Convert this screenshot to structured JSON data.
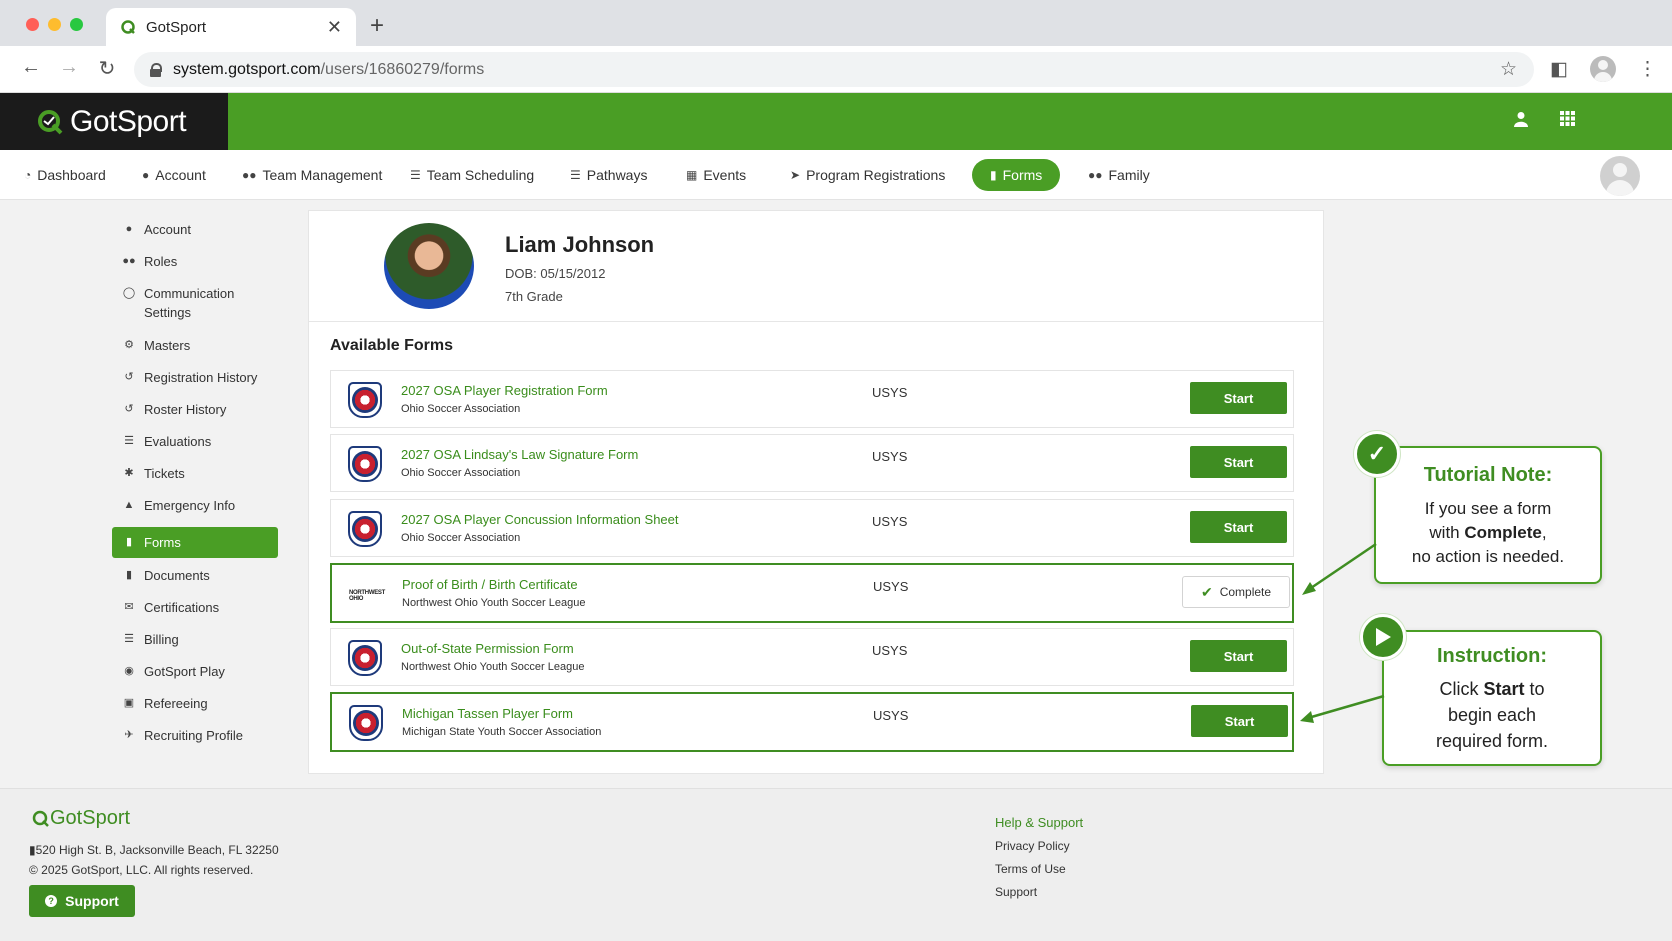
{
  "browser": {
    "tab_title": "GotSport",
    "url_host": "system.gotsport.com",
    "url_path": "/users/16860279/forms"
  },
  "header": {
    "logo": "GotSport",
    "brand_color": "#4a9e25"
  },
  "nav": {
    "items": [
      {
        "label": "Dashboard",
        "icon": "dashboard-icon"
      },
      {
        "label": "Account",
        "icon": "user-icon"
      },
      {
        "label": "Team Management",
        "icon": "users-icon"
      },
      {
        "label": "Team Scheduling",
        "icon": "list-icon"
      },
      {
        "label": "Pathways",
        "icon": "list-icon"
      },
      {
        "label": "Events",
        "icon": "calendar-icon"
      },
      {
        "label": "Program Registrations",
        "icon": "paper-plane-icon"
      },
      {
        "label": "Forms",
        "icon": "file-icon"
      },
      {
        "label": "Family",
        "icon": "users-icon"
      }
    ],
    "active": "Forms"
  },
  "sidebar": {
    "items": [
      {
        "label": "Account",
        "icon": "user-icon"
      },
      {
        "label": "Roles",
        "icon": "users-icon"
      },
      {
        "label": "Communication",
        "label2": "Settings",
        "icon": "chat-icon"
      },
      {
        "label": "Masters",
        "icon": "gear-icon"
      },
      {
        "label": "Registration History",
        "icon": "history-icon"
      },
      {
        "label": "Roster History",
        "icon": "history-icon"
      },
      {
        "label": "Evaluations",
        "icon": "list-icon"
      },
      {
        "label": "Tickets",
        "icon": "tickets-icon"
      },
      {
        "label": "Emergency Info",
        "icon": "lock-icon"
      },
      {
        "label": "Forms",
        "icon": "file-icon"
      },
      {
        "label": "Documents",
        "icon": "file-icon"
      },
      {
        "label": "Certifications",
        "icon": "envelope-icon"
      },
      {
        "label": "Billing",
        "icon": "list-icon"
      },
      {
        "label": "GotSport Play",
        "icon": "play-circle-icon"
      },
      {
        "label": "Refereeing",
        "icon": "refereeing-icon"
      },
      {
        "label": "Recruiting Profile",
        "icon": "rocket-icon"
      }
    ],
    "active": "Forms"
  },
  "profile": {
    "name": "Liam Johnson",
    "dob": "DOB: 05/15/2012",
    "grade": "7th Grade"
  },
  "forms": {
    "heading": "Available Forms",
    "rows": [
      {
        "title": "2027 OSA Player Registration Form",
        "org": "Ohio Soccer Association",
        "type": "USYS",
        "action": "Start"
      },
      {
        "title": "2027 OSA Lindsay's Law Signature Form",
        "org": "Ohio Soccer Association",
        "type": "USYS",
        "action": "Start"
      },
      {
        "title": "2027 OSA Player Concussion Information Sheet",
        "org": "Ohio Soccer Association",
        "type": "USYS",
        "action": "Start"
      },
      {
        "title": "Proof of Birth / Birth Certificate",
        "org": "Northwest Ohio Youth Soccer League",
        "type": "USYS",
        "action": "Complete",
        "badge_text": "NORTHWEST OHIO"
      },
      {
        "title": "Out-of-State Permission Form",
        "org": "Northwest Ohio Youth Soccer League",
        "type": "USYS",
        "action": "Start"
      },
      {
        "title": "Michigan Tassen Player Form",
        "org": "Michigan State Youth Soccer Association",
        "type": "USYS",
        "action": "Start"
      }
    ]
  },
  "callouts": {
    "note": {
      "title": "Tutorial Note:",
      "line1": "If you see a form",
      "line2_pre": "with ",
      "line2_bold": "Complete",
      "line2_post": ",",
      "line3": "no action is needed."
    },
    "instruction": {
      "title": "Instruction:",
      "line1_pre": "Click ",
      "line1_bold": "Start",
      "line1_post": " to",
      "line2": "begin each",
      "line3": "required form."
    }
  },
  "footer": {
    "logo": "GotSport",
    "address": "520 High St. B, Jacksonville Beach, FL 32250",
    "copyright": "© 2025 GotSport, LLC. All rights reserved.",
    "support_button": "Support",
    "links_heading": "Help & Support",
    "links": [
      "Privacy Policy",
      "Terms of Use",
      "Support"
    ]
  }
}
